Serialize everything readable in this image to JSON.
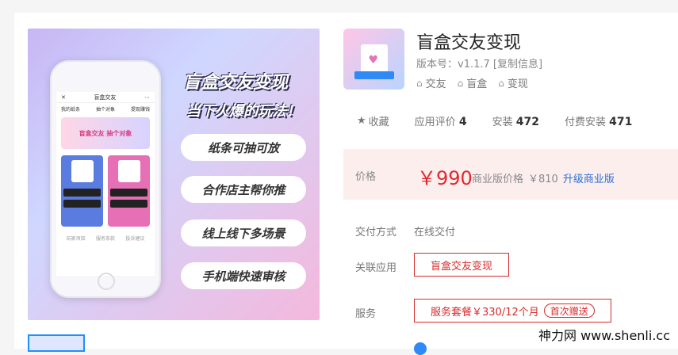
{
  "hero": {
    "title": "盲盒交友变现",
    "subtitle": "当下火爆的玩法！",
    "pills": [
      "纸条可抽可放",
      "合作店主帮你推",
      "线上线下多场景",
      "手机端快速审核"
    ],
    "phone": {
      "title": "盲盒交友",
      "tabs": [
        "我的纸条",
        "抽个对象",
        "提现赚钱"
      ],
      "banner": "盲盒交友 抽个对象",
      "footer": [
        "玩家须知",
        "服务条款",
        "投诉建议"
      ]
    }
  },
  "product": {
    "title": "盲盒交友变现",
    "version": "版本号：v1.1.7 [复制信息]",
    "tags": [
      "交友",
      "盲盒",
      "变现"
    ]
  },
  "stats": {
    "favorite": "收藏",
    "rating_label": "应用评价",
    "rating_value": "4",
    "install_label": "安装",
    "install_value": "472",
    "paid_install_label": "付费安装",
    "paid_install_value": "471"
  },
  "price": {
    "label": "价格",
    "value": "￥990",
    "biz_label": "商业版价格",
    "biz_value": "￥810",
    "upgrade": "升级商业版"
  },
  "delivery": {
    "label": "交付方式",
    "value": "在线交付"
  },
  "related": {
    "label": "关联应用",
    "value": "盲盒交友变现"
  },
  "service": {
    "label": "服务",
    "value": "服务套餐￥330/12个月",
    "badge": "首次赠送"
  },
  "watermark": "神力网 www.shenli.cc",
  "colors": {
    "price": "#e0292e",
    "link": "#2a70d6",
    "accent": "#1e90ff"
  }
}
